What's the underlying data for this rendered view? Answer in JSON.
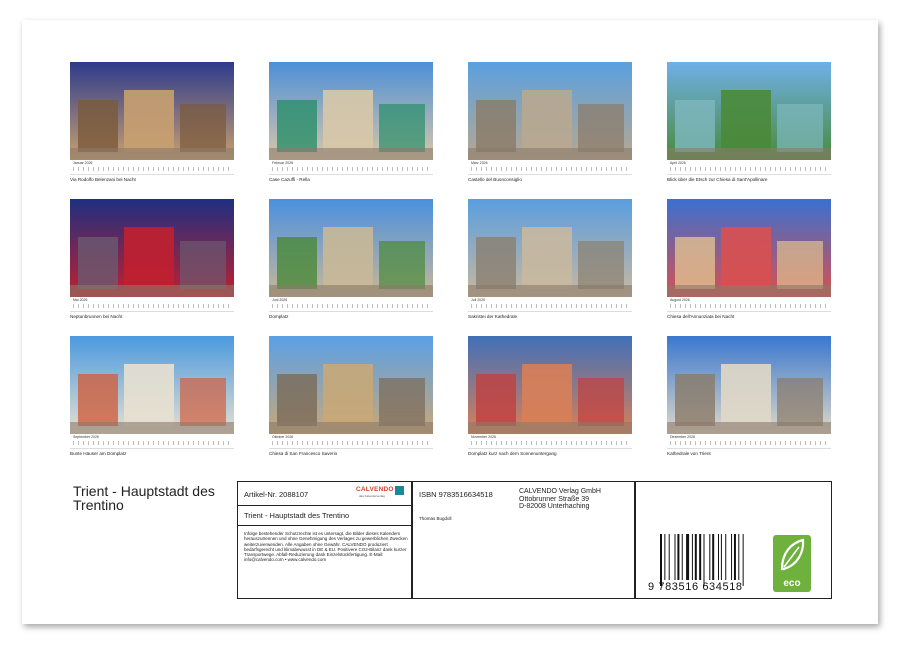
{
  "calendar": {
    "title": "Trient - Hauptstadt des Trentino",
    "months": [
      {
        "month": "Januar 2026",
        "caption": "Via Rodolfo Belenzani bei Nacht"
      },
      {
        "month": "Februar 2026",
        "caption": "Case Cazuffi - Rella"
      },
      {
        "month": "März 2026",
        "caption": "Castello del Buonconsiglio"
      },
      {
        "month": "April 2026",
        "caption": "Blick über die Etsch zur Chiesa di Sant'Apollinare"
      },
      {
        "month": "Mai 2026",
        "caption": "Neptunbrunnen bei Nacht"
      },
      {
        "month": "Juni 2026",
        "caption": "Domplatz"
      },
      {
        "month": "Juli 2026",
        "caption": "Sakristei der Kathedrale"
      },
      {
        "month": "August 2026",
        "caption": "Chiesa dell'Annunziata bei Nacht"
      },
      {
        "month": "September 2026",
        "caption": "Bunte Häuser am Domplatz"
      },
      {
        "month": "Oktober 2026",
        "caption": "Chiesa di San Francesco Saverio"
      },
      {
        "month": "November 2026",
        "caption": "Domplatz kurz nach dem Sonnenuntergang"
      },
      {
        "month": "Dezember 2026",
        "caption": "Kathedrale von Trient"
      }
    ]
  },
  "info_box": {
    "article_label": "Artikel-Nr. 2088107",
    "logo_text": "CALVENDO",
    "logo_sub": "das Kalenderverlag",
    "product_title": "Trient - Hauptstadt des Trentino",
    "legal_text": "Infolge bestehender Schutzrechte ist es untersagt, die Bilder dieses Kalenders herauszutrennen und ohne Genehmigung des Verlages zu gewerblichen Zwecken weiterzuverwenden. Alle Angaben ohne Gewähr. CALVENDO produziert bedarfsgerecht und klimabewusst in DE & EU. Positivere CO2-Bilanz dank kurzer Transportwege. Abfall-Reduzierung dank Einzelstückfertigung. E-Mail: info@calvendo.com • www.calvendo.com",
    "isbn": "ISBN 9783516634518",
    "author": "Thomas Bugdoll",
    "publisher_lines": [
      "CALVENDO Verlag GmbH",
      "Ottobrunner Straße 39",
      "D-82008 Unterhaching"
    ],
    "barcode_number": "9 783516 634518",
    "eco_label": "eco"
  },
  "colors": {
    "eco_green": "#6eb13c",
    "logo_red": "#d2482a",
    "logo_teal": "#1b8a98"
  }
}
